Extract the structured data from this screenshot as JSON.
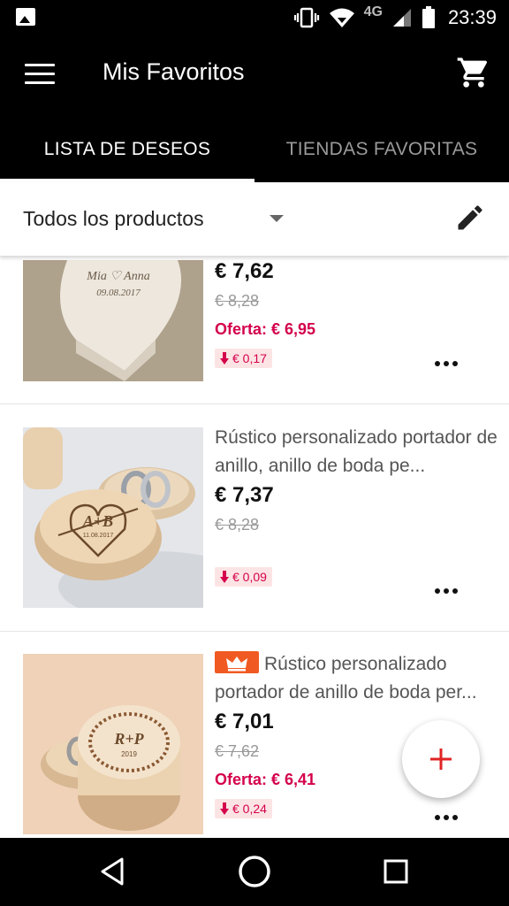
{
  "status_bar": {
    "network": "4G",
    "time": "23:39",
    "icons": [
      "image-notification-icon",
      "vibrate-icon",
      "wifi-icon",
      "signal-icon",
      "battery-icon"
    ]
  },
  "app_bar": {
    "title": "Mis Favoritos",
    "menu_icon": "hamburger-icon",
    "cart_icon": "cart-icon"
  },
  "tabs": [
    {
      "label": "LISTA DE DESEOS",
      "active": true
    },
    {
      "label": "TIENDAS FAVORITAS",
      "active": false
    }
  ],
  "filter": {
    "label": "Todos los productos",
    "edit_icon": "pencil-icon"
  },
  "items": [
    {
      "title": "",
      "price": "€ 7,62",
      "old_price": "€ 8,28",
      "offer": "Oferta: € 6,95",
      "drop": "€ 0,17",
      "thumb": "heart-box",
      "thumb_text": [
        "Mia ♡ Anna",
        "09.08.2017"
      ]
    },
    {
      "title": "Rústico personalizado portador de anillo, anillo de boda pe...",
      "price": "€ 7,37",
      "old_price": "€ 8,28",
      "offer": "",
      "drop": "€ 0,09",
      "thumb": "round-box-heart",
      "thumb_text": [
        "A+B",
        "11.08.2017"
      ]
    },
    {
      "title": "Rústico personalizado portador de anillo de boda per...",
      "price": "€ 7,01",
      "old_price": "€ 7,62",
      "offer": "Oferta: € 6,41",
      "drop": "€ 0,24",
      "thumb": "round-box-wreath",
      "thumb_text": [
        "R+P",
        "2019"
      ],
      "badge": "crown-icon"
    }
  ],
  "fab": {
    "icon": "plus-icon"
  },
  "colors": {
    "accent_red": "#d4004c",
    "badge_orange": "#f05a22",
    "fab_plus": "#e02424"
  },
  "nav_bar": [
    "back-icon",
    "home-icon",
    "recents-icon"
  ]
}
